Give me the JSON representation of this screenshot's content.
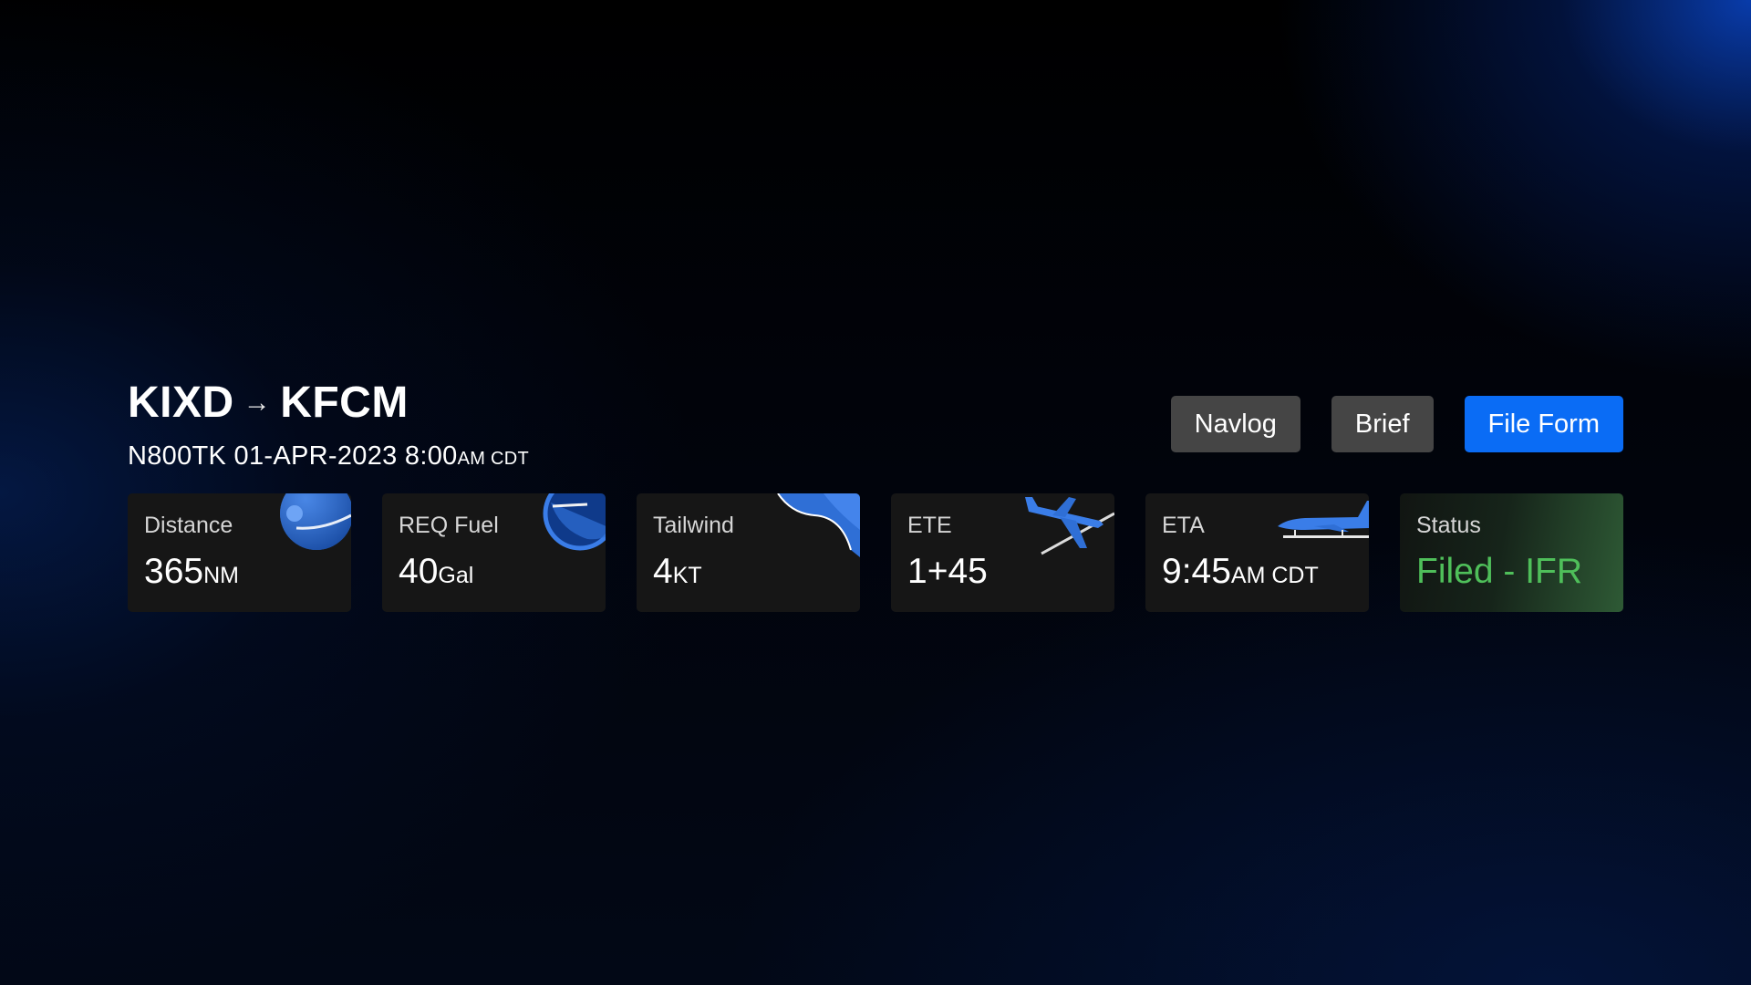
{
  "flight": {
    "origin": "KIXD",
    "route_arrow": "→",
    "destination": "KFCM",
    "tail_date": "N800TK 01-APR-2023 8:00",
    "time_suffix": "AM CDT"
  },
  "actions": {
    "navlog_label": "Navlog",
    "brief_label": "Brief",
    "file_form_label": "File Form"
  },
  "cards": {
    "distance": {
      "label": "Distance",
      "value": "365",
      "unit": "NM",
      "icon": "globe-icon"
    },
    "fuel": {
      "label": "REQ Fuel",
      "value": "40",
      "unit": "Gal",
      "icon": "fuel-gauge-icon"
    },
    "tailwind": {
      "label": "Tailwind",
      "value": "4",
      "unit": "KT",
      "icon": "wind-icon"
    },
    "ete": {
      "label": "ETE",
      "value": "1+45",
      "icon": "airplane-takeoff-icon"
    },
    "eta": {
      "label": "ETA",
      "value": "9:45",
      "unit": "AM CDT",
      "icon": "airplane-landing-icon"
    },
    "status": {
      "label": "Status",
      "value": "Filed - IFR"
    }
  },
  "colors": {
    "accent_blue": "#0a6cf5",
    "status_green": "#4fbf5a",
    "card_bg": "#161616",
    "button_gray": "#454545"
  }
}
